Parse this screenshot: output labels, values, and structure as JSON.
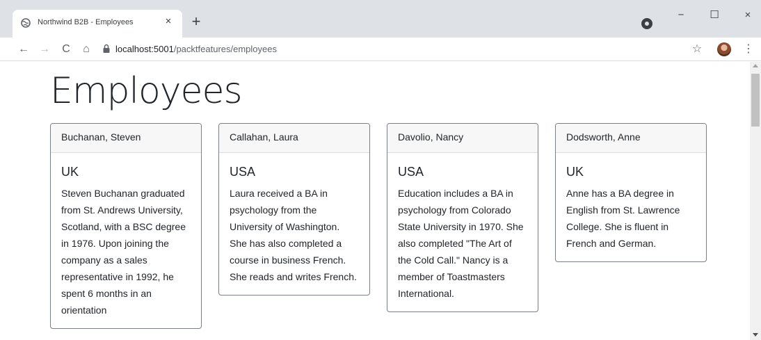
{
  "browser": {
    "tab_title": "Northwind B2B - Employees",
    "tab_close": "×",
    "new_tab": "+",
    "url_host": "localhost:5001",
    "url_path": "/packtfeatures/employees",
    "nav": {
      "back": "←",
      "forward": "→",
      "reload": "C",
      "home": "⌂"
    },
    "window": {
      "minimize": "−",
      "maximize": "☐",
      "close": "×"
    },
    "star": "☆",
    "menu": "⋮"
  },
  "page": {
    "title": "Employees",
    "employees": [
      {
        "name": "Buchanan, Steven",
        "country": "UK",
        "notes": "Steven Buchanan graduated from St. Andrews University, Scotland, with a BSC degree in 1976. Upon joining the company as a sales representative in 1992, he spent 6 months in an orientation"
      },
      {
        "name": "Callahan, Laura",
        "country": "USA",
        "notes": "Laura received a BA in psychology from the University of Washington. She has also completed a course in business French. She reads and writes French."
      },
      {
        "name": "Davolio, Nancy",
        "country": "USA",
        "notes": "Education includes a BA in psychology from Colorado State University in 1970. She also completed \"The Art of the Cold Call.\" Nancy is a member of Toastmasters International."
      },
      {
        "name": "Dodsworth, Anne",
        "country": "UK",
        "notes": "Anne has a BA degree in English from St. Lawrence College. She is fluent in French and German."
      }
    ]
  }
}
